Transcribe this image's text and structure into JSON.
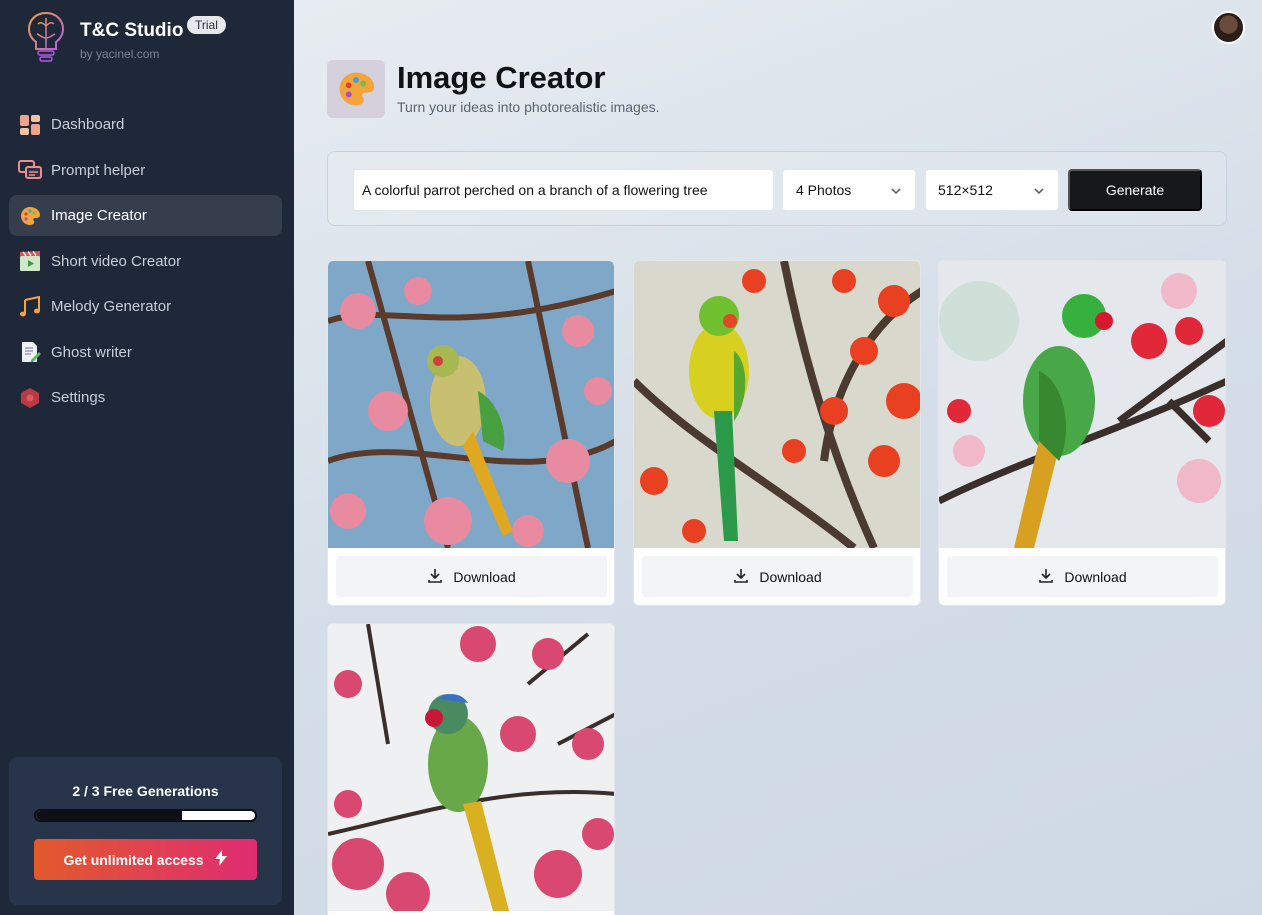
{
  "app": {
    "brand": "T&C Studio",
    "badge": "Trial",
    "byline": "by yacinel.com"
  },
  "sidebar": {
    "items": [
      {
        "label": "Dashboard",
        "icon": "dashboard-icon"
      },
      {
        "label": "Prompt helper",
        "icon": "chat-bubbles-icon"
      },
      {
        "label": "Image Creator",
        "icon": "palette-icon",
        "active": true
      },
      {
        "label": "Short video Creator",
        "icon": "clapperboard-icon"
      },
      {
        "label": "Melody Generator",
        "icon": "music-notes-icon"
      },
      {
        "label": "Ghost writer",
        "icon": "document-pencil-icon"
      },
      {
        "label": "Settings",
        "icon": "settings-hexagon-icon"
      }
    ]
  },
  "plan": {
    "title": "2 / 3 Free Generations",
    "used": 2,
    "total": 3,
    "upgrade_label": "Get unlimited access"
  },
  "header": {
    "title": "Image Creator",
    "subtitle": "Turn your ideas into photorealistic images."
  },
  "form": {
    "prompt_value": "A colorful parrot perched on a branch of a flowering tree",
    "count_value": "4 Photos",
    "size_value": "512×512",
    "generate_label": "Generate"
  },
  "results": {
    "download_label": "Download",
    "count": 4
  },
  "colors": {
    "sidebar_bg": "#1f2838",
    "active_item_bg": "#363e4e",
    "accent_gradient_start": "#e25a2b",
    "accent_gradient_end": "#de2c72",
    "generate_bg": "#16181c"
  }
}
